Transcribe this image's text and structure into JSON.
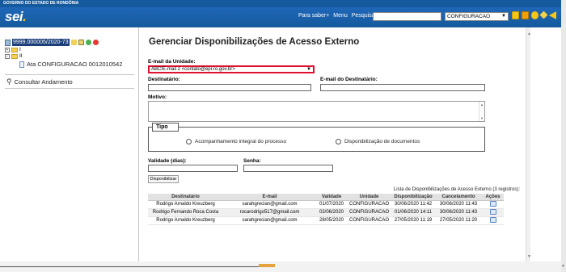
{
  "gov_bar": {
    "text": "GOVERNO DO ESTADO DE RONDÔNIA"
  },
  "header": {
    "logo": "sei",
    "logo_dot": ".",
    "links": [
      "Para saber+",
      "Menu",
      "Pesquisa"
    ],
    "search_value": "",
    "unit_select": "CONFIGURACAO",
    "icons": [
      "controle-processos-icon",
      "novidades-icon",
      "usuario-icon",
      "configuracoes-icon",
      "sair-icon"
    ],
    "icon_colors": [
      "#f5c518",
      "#e4a100",
      "#8bbd2c",
      "#f5c518",
      "#f0f0f0"
    ]
  },
  "left": {
    "process_number": "9999.000005/2020-73",
    "folders": [
      "I",
      "II"
    ],
    "document": "Ata CONFIGURACAO 0012010542",
    "consult_label": "Consultar Andamento"
  },
  "main": {
    "title": "Gerenciar Disponibilizações de Acesso Externo",
    "email_unit_label": "E-mail da Unidade:",
    "email_unit_value": "ABC/E-mail 2 <contato@epr.ro.gov.br>",
    "dest_label": "Destinatário:",
    "dest_value": "",
    "dest_email_label": "E-mail do Destinatário:",
    "dest_email_value": "",
    "motivo_label": "Motivo:",
    "tipo_legend": "Tipo",
    "radio_integral": "Acompanhamento integral do processo",
    "radio_docs": "Disponibilização de documentos",
    "validade_label": "Validade (dias):",
    "senha_label": "Senha:",
    "disponibilizar_label": "Disponibilizar",
    "table_caption": "Lista de Disponibilizações de Acesso Externo (3 registros):",
    "table": {
      "headers": [
        "Destinatário",
        "E-mail",
        "Validade",
        "Unidade",
        "Disponibilização",
        "Cancelamento",
        "Ações"
      ],
      "rows": [
        [
          "Rodrigo Arnaldo Kreuzberg",
          "sarahgrecian@gmail.com",
          "01/07/2020",
          "CONFIGURACAO",
          "30/06/2020 11:42",
          "30/06/2020 11:43"
        ],
        [
          "Rodrigo Fernando Roca Costa",
          "rocarodrigo517@gmail.com",
          "02/06/2020",
          "CONFIGURACAO",
          "01/06/2020 14:11",
          "30/06/2020 11:43"
        ],
        [
          "Rodrigo Arnaldo Kreuzberg",
          "sarahgrecian@gmail.com",
          "28/05/2020",
          "CONFIGURACAO",
          "27/05/2020 11:19",
          "27/05/2020 11:20"
        ]
      ]
    }
  }
}
